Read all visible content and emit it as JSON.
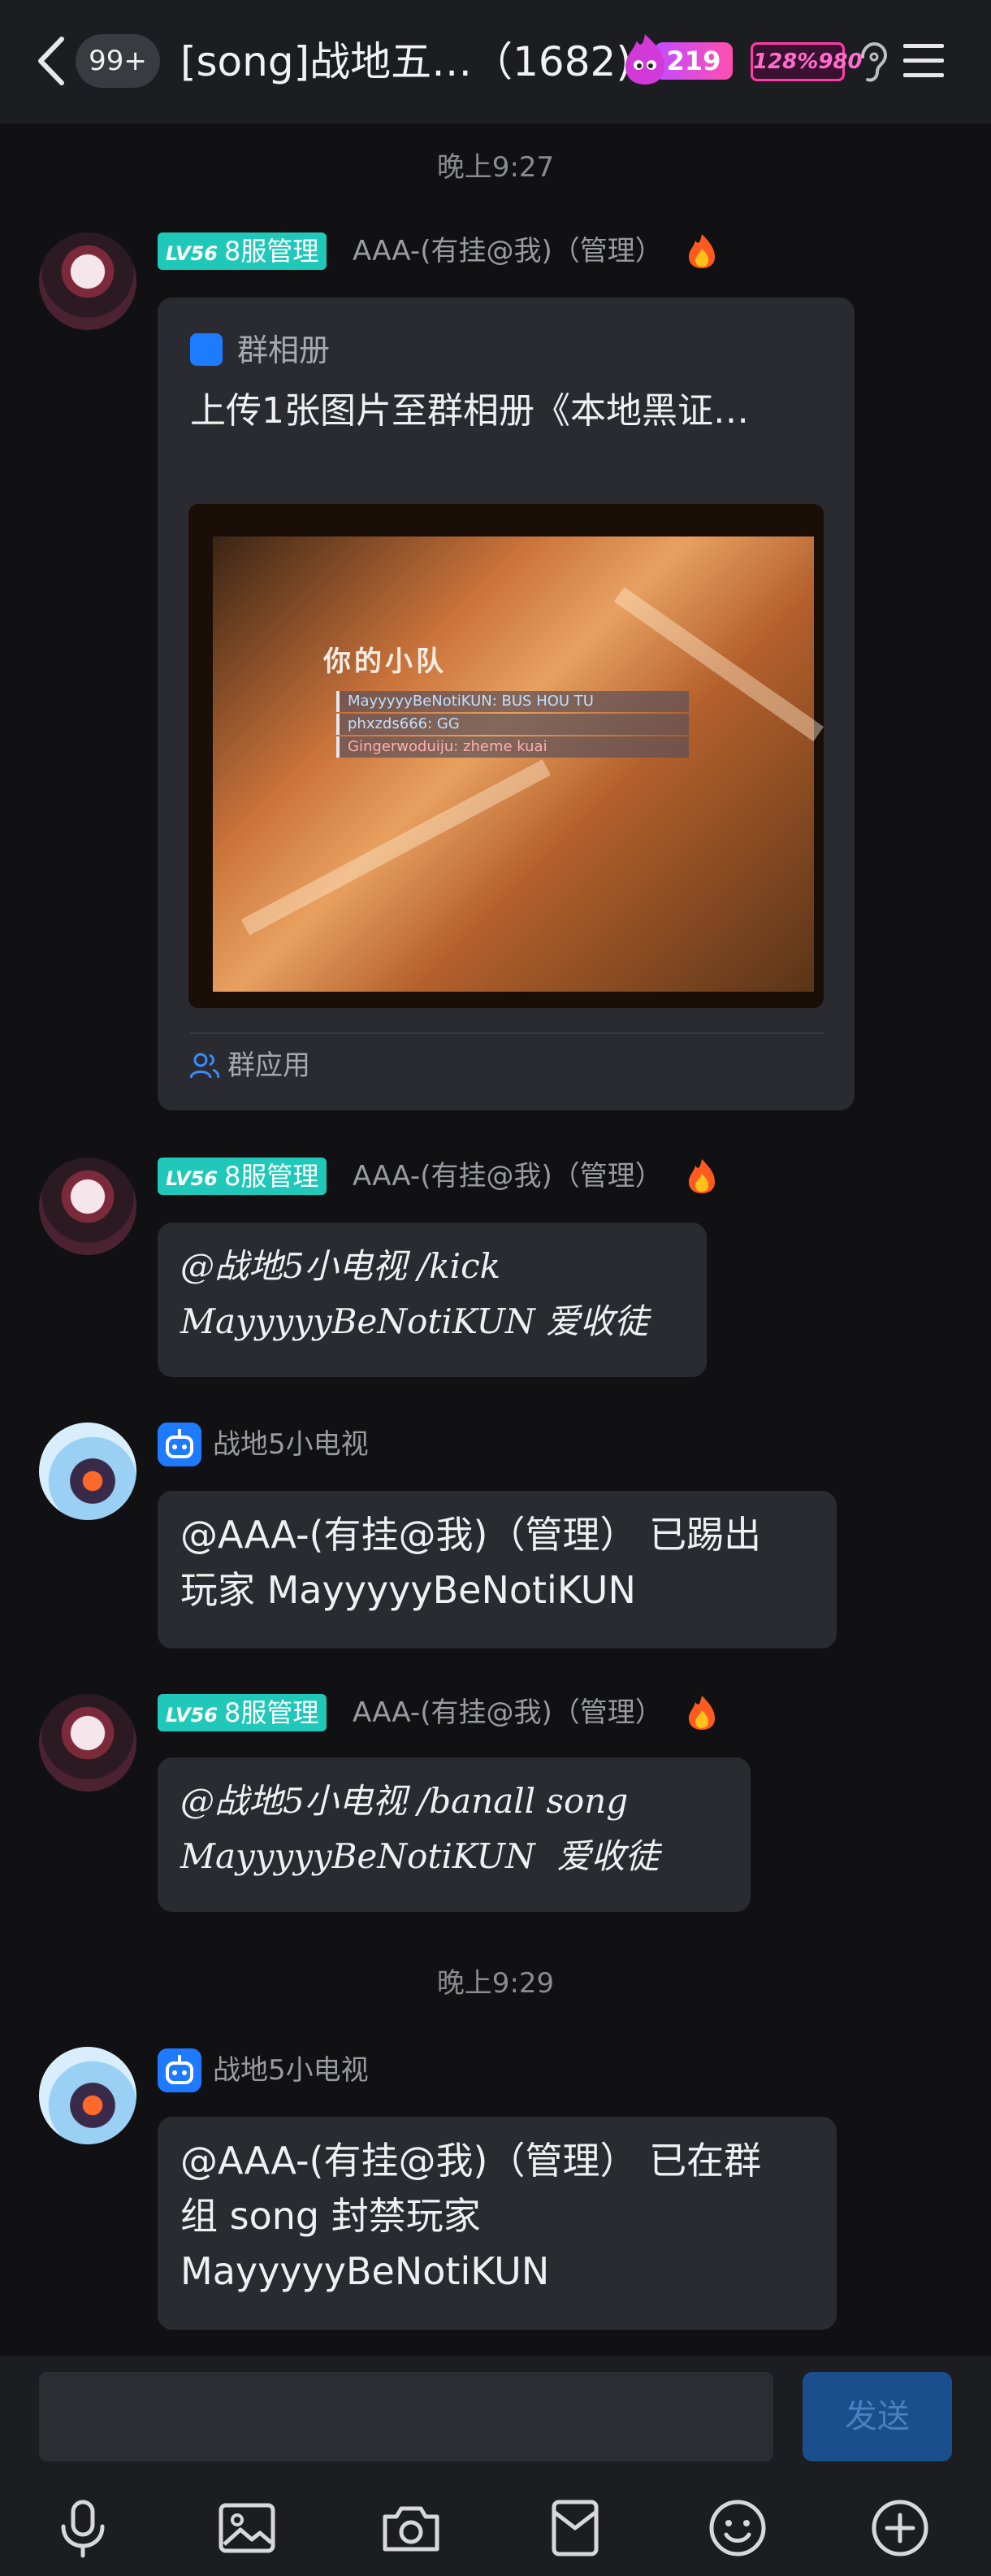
{
  "header": {
    "unread": "99+",
    "title": "[song]战地五…（1682)",
    "fire_count": "219",
    "level_badge": "128%980"
  },
  "timestamps": [
    "晚上9:27",
    "晚上9:29"
  ],
  "messages": [
    {
      "badge_lv": "LV56",
      "badge_title": "8服管理",
      "nick": "AAA-(有挂@我)（管理）",
      "card": {
        "source": "群相册",
        "title": "上传1张图片至群相册《本地黑证…",
        "photo_heading": "你的小队",
        "photo_rows": [
          "MayyyyyBeNotiKUN: BUS HOU TU",
          "phxzds666: GG",
          "Gingerwoduiju: zheme kuai"
        ],
        "footer": "群应用"
      }
    },
    {
      "badge_lv": "LV56",
      "badge_title": "8服管理",
      "nick": "AAA-(有挂@我)（管理）",
      "text": "@战地5小电视 /kick\nMayyyyyBeNotiKUN 爱收徒"
    },
    {
      "nick": "战地5小电视",
      "text": "@AAA-(有挂@我)（管理） 已踢出\n玩家 MayyyyyBeNotiKUN"
    },
    {
      "badge_lv": "LV56",
      "badge_title": "8服管理",
      "nick": "AAA-(有挂@我)（管理）",
      "text": "@战地5小电视 /banall song\nMayyyyyBeNotiKUN  爱收徒"
    },
    {
      "nick": "战地5小电视",
      "text": "@AAA-(有挂@我)（管理） 已在群\n组 song 封禁玩家\nMayyyyyBeNotiKUN"
    }
  ],
  "input": {
    "send_label": "发送"
  },
  "colors": {
    "badge_teal": "#1fc8b8",
    "bot_blue": "#1e7bff",
    "bubble": "#2a2b30",
    "background": "#111113"
  }
}
